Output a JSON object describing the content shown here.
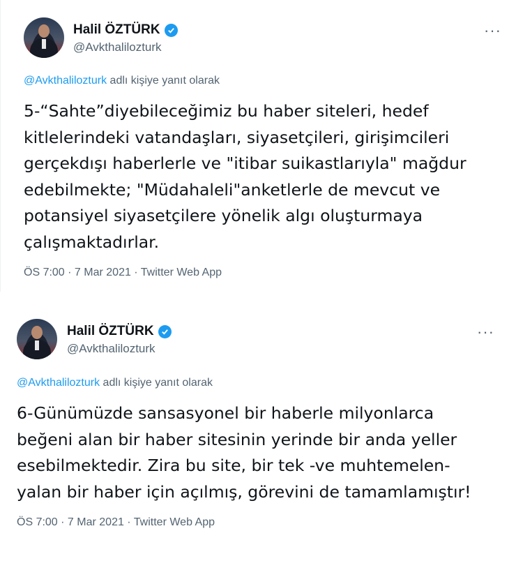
{
  "tweets": [
    {
      "author_name": "Halil ÖZTÜRK",
      "author_handle": "@Avkthalilozturk",
      "reply_mention": "@Avkthalilozturk",
      "reply_suffix": " adlı kişiye yanıt olarak",
      "text": "5-“Sahte”diyebileceğimiz bu haber siteleri, hedef\nkitlelerindeki vatandaşları, siyasetçileri, girişimcileri\ngerçekdışı haberlerle ve \"itibar suikastlarıyla\" mağdur\nedebilmekte; \"Müdahaleli\"anketlerle de mevcut ve\npotansiyel siyasetçilere yönelik algı oluşturmaya\nçalışmaktadırlar.",
      "meta": "ÖS 7:00 · 7 Mar 2021 · Twitter Web App",
      "more_icon": "···"
    },
    {
      "author_name": "Halil ÖZTÜRK",
      "author_handle": "@Avkthalilozturk",
      "reply_mention": "@Avkthalilozturk",
      "reply_suffix": " adlı kişiye yanıt olarak",
      "text": "6-Günümüzde sansasyonel bir haberle milyonlarca\nbeğeni alan bir haber sitesinin yerinde bir anda yeller\nesebilmektedir. Zira bu site, bir tek -ve muhtemelen-\nyalan bir haber için açılmış, görevini de tamamlamıştır!",
      "meta": "ÖS 7:00 · 7 Mar 2021 · Twitter Web App",
      "more_icon": "···"
    }
  ],
  "colors": {
    "accent": "#1d9bf0",
    "secondary_text": "#536471",
    "primary_text": "#0f1419"
  }
}
